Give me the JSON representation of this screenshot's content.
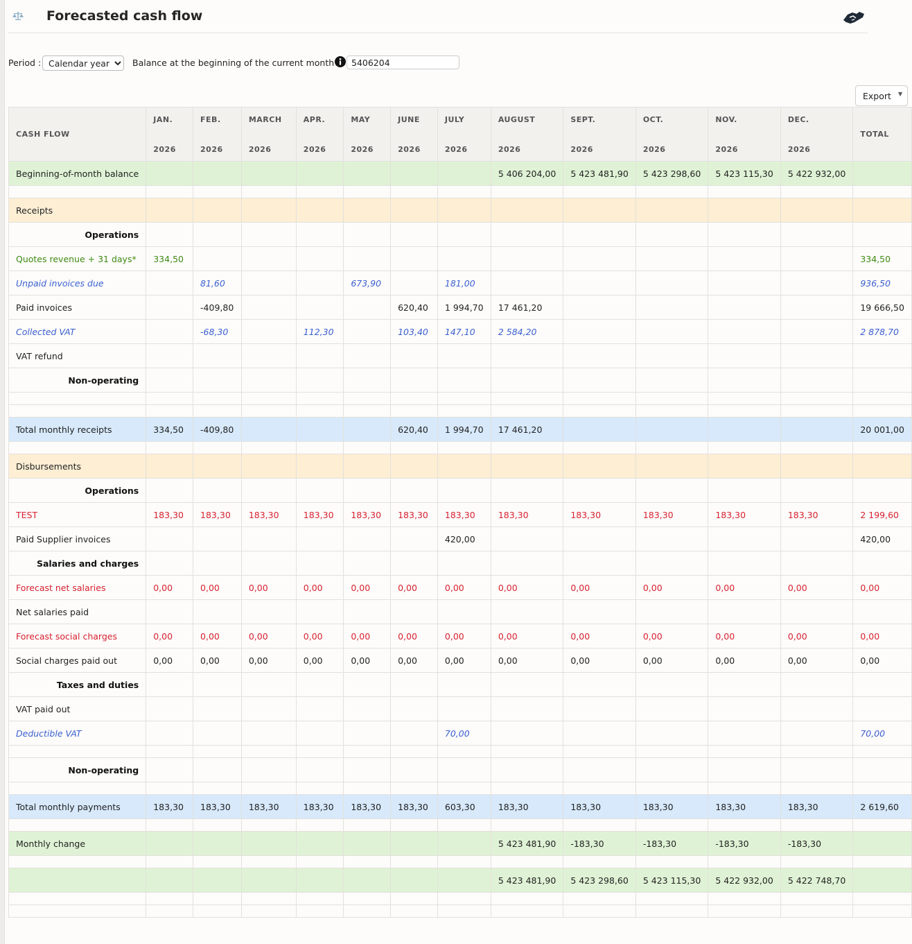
{
  "header": {
    "title": "Forecasted cash flow"
  },
  "filters": {
    "period_label": "Period :",
    "period_value": "Calendar year",
    "balance_label": "Balance at the beginning of the current month :",
    "balance_value": "5406204"
  },
  "toolbar": {
    "export_label": "Export"
  },
  "table": {
    "first_header": "CASH FLOW",
    "total_header": "TOTAL",
    "months": [
      {
        "m": "JAN.",
        "y": "2026"
      },
      {
        "m": "FEB.",
        "y": "2026"
      },
      {
        "m": "MARCH",
        "y": "2026"
      },
      {
        "m": "APR.",
        "y": "2026"
      },
      {
        "m": "MAY",
        "y": "2026"
      },
      {
        "m": "JUNE",
        "y": "2026"
      },
      {
        "m": "JULY",
        "y": "2026"
      },
      {
        "m": "AUGUST",
        "y": "2026"
      },
      {
        "m": "SEPT.",
        "y": "2026"
      },
      {
        "m": "OCT.",
        "y": "2026"
      },
      {
        "m": "NOV.",
        "y": "2026"
      },
      {
        "m": "DEC.",
        "y": "2026"
      }
    ],
    "rows": [
      {
        "style": "green",
        "label": "Beginning-of-month balance",
        "cells": [
          "",
          "",
          "",
          "",
          "",
          "",
          "",
          "5 406 204,00",
          "5 423 481,90",
          "5 423 298,60",
          "5 423 115,30",
          "5 422 932,00",
          ""
        ]
      },
      {
        "style": "spacer"
      },
      {
        "style": "orange",
        "label": "Receipts",
        "cells": [
          "",
          "",
          "",
          "",
          "",
          "",
          "",
          "",
          "",
          "",
          "",
          "",
          ""
        ]
      },
      {
        "style": "section",
        "label": "Operations",
        "cells": [
          "",
          "",
          "",
          "",
          "",
          "",
          "",
          "",
          "",
          "",
          "",
          "",
          ""
        ]
      },
      {
        "style": "olive",
        "label": "Quotes revenue + 31 days*",
        "cells": [
          "334,50",
          "",
          "",
          "",
          "",
          "",
          "",
          "",
          "",
          "",
          "",
          "",
          "334,50"
        ]
      },
      {
        "style": "bi",
        "label": "Unpaid invoices due",
        "cells": [
          "",
          "81,60",
          "",
          "",
          "673,90",
          "",
          "181,00",
          "",
          "",
          "",
          "",
          "",
          "936,50"
        ]
      },
      {
        "style": "plain",
        "label": "Paid invoices",
        "cells": [
          "",
          "-409,80",
          "",
          "",
          "",
          "620,40",
          "1 994,70",
          "17 461,20",
          "",
          "",
          "",
          "",
          "19 666,50"
        ]
      },
      {
        "style": "bi",
        "label": "Collected VAT",
        "cells": [
          "",
          "-68,30",
          "",
          "112,30",
          "",
          "103,40",
          "147,10",
          "2 584,20",
          "",
          "",
          "",
          "",
          "2 878,70"
        ]
      },
      {
        "style": "plain",
        "label": "VAT refund",
        "cells": [
          "",
          "",
          "",
          "",
          "",
          "",
          "",
          "",
          "",
          "",
          "",
          "",
          ""
        ]
      },
      {
        "style": "section",
        "label": "Non-operating",
        "cells": [
          "",
          "",
          "",
          "",
          "",
          "",
          "",
          "",
          "",
          "",
          "",
          "",
          ""
        ]
      },
      {
        "style": "spacer"
      },
      {
        "style": "spacer"
      },
      {
        "style": "blue",
        "label": "Total monthly receipts",
        "cells": [
          "334,50",
          "-409,80",
          "",
          "",
          "",
          "620,40",
          "1 994,70",
          "17 461,20",
          "",
          "",
          "",
          "",
          "20 001,00"
        ]
      },
      {
        "style": "spacer"
      },
      {
        "style": "orange",
        "label": "Disbursements",
        "cells": [
          "",
          "",
          "",
          "",
          "",
          "",
          "",
          "",
          "",
          "",
          "",
          "",
          ""
        ]
      },
      {
        "style": "section",
        "label": "Operations",
        "cells": [
          "",
          "",
          "",
          "",
          "",
          "",
          "",
          "",
          "",
          "",
          "",
          "",
          ""
        ]
      },
      {
        "style": "red",
        "label": "TEST",
        "cells": [
          "183,30",
          "183,30",
          "183,30",
          "183,30",
          "183,30",
          "183,30",
          "183,30",
          "183,30",
          "183,30",
          "183,30",
          "183,30",
          "183,30",
          "2 199,60"
        ]
      },
      {
        "style": "plain",
        "label": "Paid Supplier invoices",
        "cells": [
          "",
          "",
          "",
          "",
          "",
          "",
          "420,00",
          "",
          "",
          "",
          "",
          "",
          "420,00"
        ]
      },
      {
        "style": "section",
        "label": "Salaries and charges",
        "cells": [
          "",
          "",
          "",
          "",
          "",
          "",
          "",
          "",
          "",
          "",
          "",
          "",
          ""
        ]
      },
      {
        "style": "red",
        "label": "Forecast net salaries",
        "cells": [
          "0,00",
          "0,00",
          "0,00",
          "0,00",
          "0,00",
          "0,00",
          "0,00",
          "0,00",
          "0,00",
          "0,00",
          "0,00",
          "0,00",
          "0,00"
        ]
      },
      {
        "style": "plain",
        "label": "Net salaries paid",
        "cells": [
          "",
          "",
          "",
          "",
          "",
          "",
          "",
          "",
          "",
          "",
          "",
          "",
          ""
        ]
      },
      {
        "style": "red",
        "label": "Forecast social charges",
        "cells": [
          "0,00",
          "0,00",
          "0,00",
          "0,00",
          "0,00",
          "0,00",
          "0,00",
          "0,00",
          "0,00",
          "0,00",
          "0,00",
          "0,00",
          "0,00"
        ]
      },
      {
        "style": "plain",
        "label": "Social charges paid out",
        "cells": [
          "0,00",
          "0,00",
          "0,00",
          "0,00",
          "0,00",
          "0,00",
          "0,00",
          "0,00",
          "0,00",
          "0,00",
          "0,00",
          "0,00",
          "0,00"
        ]
      },
      {
        "style": "section",
        "label": "Taxes and duties",
        "cells": [
          "",
          "",
          "",
          "",
          "",
          "",
          "",
          "",
          "",
          "",
          "",
          "",
          ""
        ]
      },
      {
        "style": "plain",
        "label": "VAT paid out",
        "cells": [
          "",
          "",
          "",
          "",
          "",
          "",
          "",
          "",
          "",
          "",
          "",
          "",
          ""
        ]
      },
      {
        "style": "bi",
        "label": "Deductible VAT",
        "cells": [
          "",
          "",
          "",
          "",
          "",
          "",
          "70,00",
          "",
          "",
          "",
          "",
          "",
          "70,00"
        ]
      },
      {
        "style": "spacer"
      },
      {
        "style": "section",
        "label": "Non-operating",
        "cells": [
          "",
          "",
          "",
          "",
          "",
          "",
          "",
          "",
          "",
          "",
          "",
          "",
          ""
        ]
      },
      {
        "style": "spacer"
      },
      {
        "style": "blue",
        "label": "Total monthly payments",
        "cells": [
          "183,30",
          "183,30",
          "183,30",
          "183,30",
          "183,30",
          "183,30",
          "603,30",
          "183,30",
          "183,30",
          "183,30",
          "183,30",
          "183,30",
          "2 619,60"
        ]
      },
      {
        "style": "spacer"
      },
      {
        "style": "green",
        "label": "Monthly change",
        "cells": [
          "",
          "",
          "",
          "",
          "",
          "",
          "",
          "5 423 481,90",
          "-183,30",
          "-183,30",
          "-183,30",
          "-183,30",
          ""
        ]
      },
      {
        "style": "spacer"
      },
      {
        "style": "green",
        "label": "",
        "cells": [
          "",
          "",
          "",
          "",
          "",
          "",
          "",
          "5 423 481,90",
          "5 423 298,60",
          "5 423 115,30",
          "5 422 932,00",
          "5 422 748,70",
          ""
        ]
      },
      {
        "style": "spacer"
      },
      {
        "style": "spacer"
      }
    ]
  }
}
